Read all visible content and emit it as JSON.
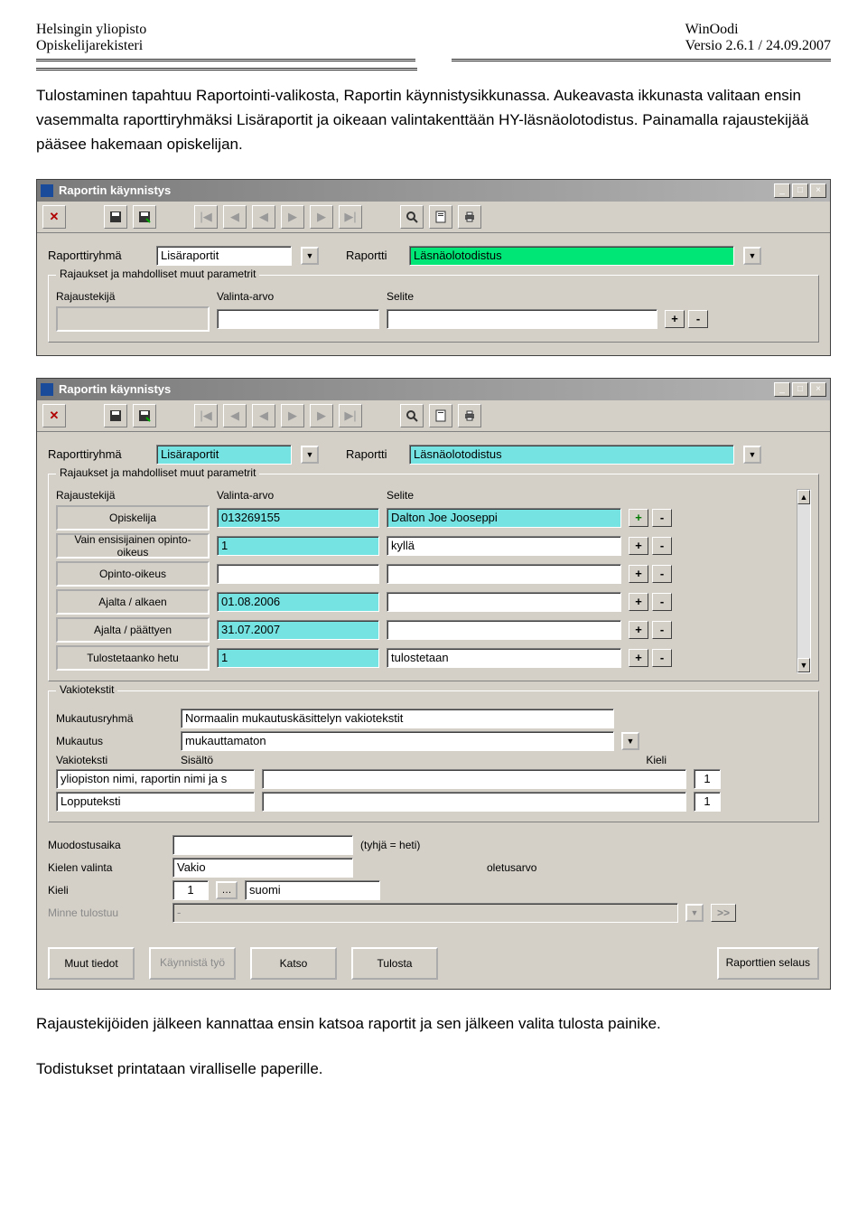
{
  "header": {
    "left1": "Helsingin yliopisto",
    "left2": "Opiskelijarekisteri",
    "right1": "WinOodi",
    "right2": "Versio 2.6.1 / 24.09.2007"
  },
  "paragraph1": "Tulostaminen tapahtuu Raportointi-valikosta, Raportin käynnistysikkunassa. Aukeavasta ikkunasta valitaan ensin vasemmalta raporttiryhmäksi Lisäraportit ja oikeaan valintakenttään HY-läsnäolotodistus. Painamalla rajaustekijää pääsee hakemaan opiskelijan.",
  "window": {
    "title": "Raportin käynnistys",
    "raporttiryhma_label": "Raporttiryhmä",
    "raportti_label": "Raportti",
    "group_title": "Rajaukset ja mahdolliset muut parametrit",
    "col_rajaustekija": "Rajaustekijä",
    "col_valinta": "Valinta-arvo",
    "col_selite": "Selite"
  },
  "win1": {
    "raporttiryhma_value": "Lisäraportit",
    "raportti_value": "Läsnäolotodistus"
  },
  "win2": {
    "raporttiryhma_value": "Lisäraportit",
    "raportti_value": "Läsnäolotodistus",
    "rows": [
      {
        "label": "Opiskelija",
        "value": "013269155",
        "selite": "Dalton Joe Jooseppi",
        "val_hi": true,
        "sel_hi": true
      },
      {
        "label": "Vain ensisijainen opinto-oikeus",
        "value": "1",
        "selite": "kyllä",
        "val_hi": true,
        "sel_hi": false
      },
      {
        "label": "Opinto-oikeus",
        "value": "",
        "selite": "",
        "val_hi": false,
        "sel_hi": false
      },
      {
        "label": "Ajalta / alkaen",
        "value": "01.08.2006",
        "selite": "",
        "val_hi": true,
        "sel_hi": false
      },
      {
        "label": "Ajalta / päättyen",
        "value": "31.07.2007",
        "selite": "",
        "val_hi": true,
        "sel_hi": false
      },
      {
        "label": "Tulostetaanko hetu",
        "value": "1",
        "selite": "tulostetaan",
        "val_hi": true,
        "sel_hi": false
      }
    ],
    "vakio": {
      "group": "Vakiotekstit",
      "muk_ryhma_lbl": "Mukautusryhmä",
      "muk_ryhma_val": "Normaalin mukautuskäsittelyn vakiotekstit",
      "muk_lbl": "Mukautus",
      "muk_val": "mukauttamaton",
      "vt_lbl": "Vakioteksti",
      "sis_lbl": "Sisältö",
      "kieli_lbl": "Kieli",
      "r1": "yliopiston nimi, raportin nimi ja s",
      "r1_kieli": "1",
      "r2": "Lopputeksti",
      "r2_kieli": "1"
    },
    "bottom": {
      "muodostus_lbl": "Muodostusaika",
      "muodostus_hint": "(tyhjä = heti)",
      "kielenvalinta_lbl": "Kielen valinta",
      "kielenvalinta_val": "Vakio",
      "oletus": "oletusarvo",
      "kieli_lbl": "Kieli",
      "kieli_num": "1",
      "kieli_name": "suomi",
      "minne_lbl": "Minne tulostuu",
      "minne_val": "-"
    },
    "buttons": {
      "muut": "Muut tiedot",
      "kaynnista": "Käynnistä työ",
      "katso": "Katso",
      "tulosta": "Tulosta",
      "selaus": "Raporttien selaus"
    }
  },
  "outro1": "Rajaustekijöiden jälkeen kannattaa ensin katsoa raportit ja sen jälkeen valita tulosta painike.",
  "outro2": "Todistukset printataan viralliselle paperille."
}
